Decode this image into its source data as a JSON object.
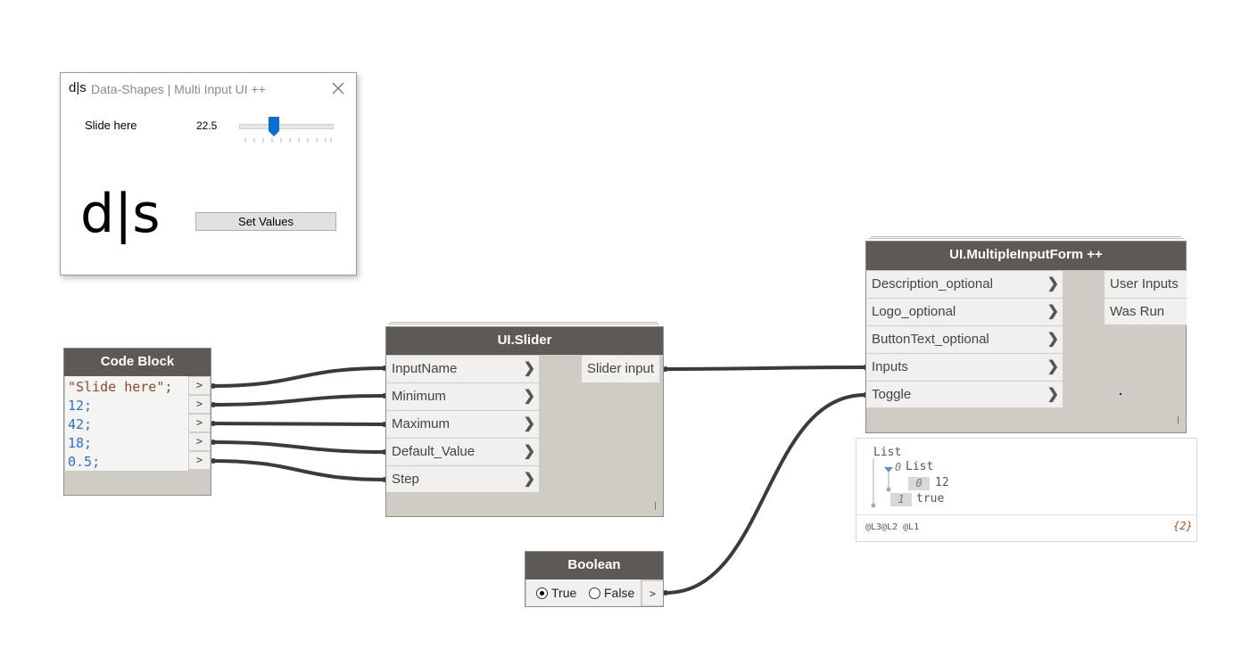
{
  "dialog": {
    "logo_small": "d|s",
    "title": "Data-Shapes | Multi Input UI ++",
    "slider_label": "Slide here",
    "slider_value": "22.5",
    "slider": {
      "min": 12,
      "max": 42,
      "value": 22.5
    },
    "logo_big": "d|s",
    "button_label": "Set Values"
  },
  "code_block": {
    "title": "Code Block",
    "lines": [
      {
        "text": "\"Slide here\";",
        "color": "#8b4a2b"
      },
      {
        "text": "12;",
        "color": "#2d6fd1"
      },
      {
        "text": "42;",
        "color": "#2d6fd1"
      },
      {
        "text": "18;",
        "color": "#2d6fd1"
      },
      {
        "text": "0.5;",
        "color": "#2d6fd1"
      }
    ],
    "port_glyph": ">"
  },
  "slider_node": {
    "title": "UI.Slider",
    "inputs": [
      "InputName",
      "Minimum",
      "Maximum",
      "Default_Value",
      "Step"
    ],
    "output": "Slider input"
  },
  "form_node": {
    "title": "UI.MultipleInputForm ++",
    "inputs": [
      "Description_optional",
      "Logo_optional",
      "ButtonText_optional",
      "Inputs",
      "Toggle"
    ],
    "outputs": [
      "User Inputs",
      "Was Run"
    ]
  },
  "boolean_node": {
    "title": "Boolean",
    "true_label": "True",
    "false_label": "False",
    "selected": "True",
    "port_glyph": ">"
  },
  "preview": {
    "root": "List",
    "sub_index": "0",
    "sub_label": "List",
    "item0_index": "0",
    "item0_value": "12",
    "item1_index": "1",
    "item1_value": "true",
    "levels": "@L3@L2 @L1",
    "count": "{2}"
  },
  "colors": {
    "node_header": "#5c5956",
    "node_body": "#cfcbc5",
    "wire": "#3d3b39",
    "slider_thumb": "#0a6cd6"
  }
}
